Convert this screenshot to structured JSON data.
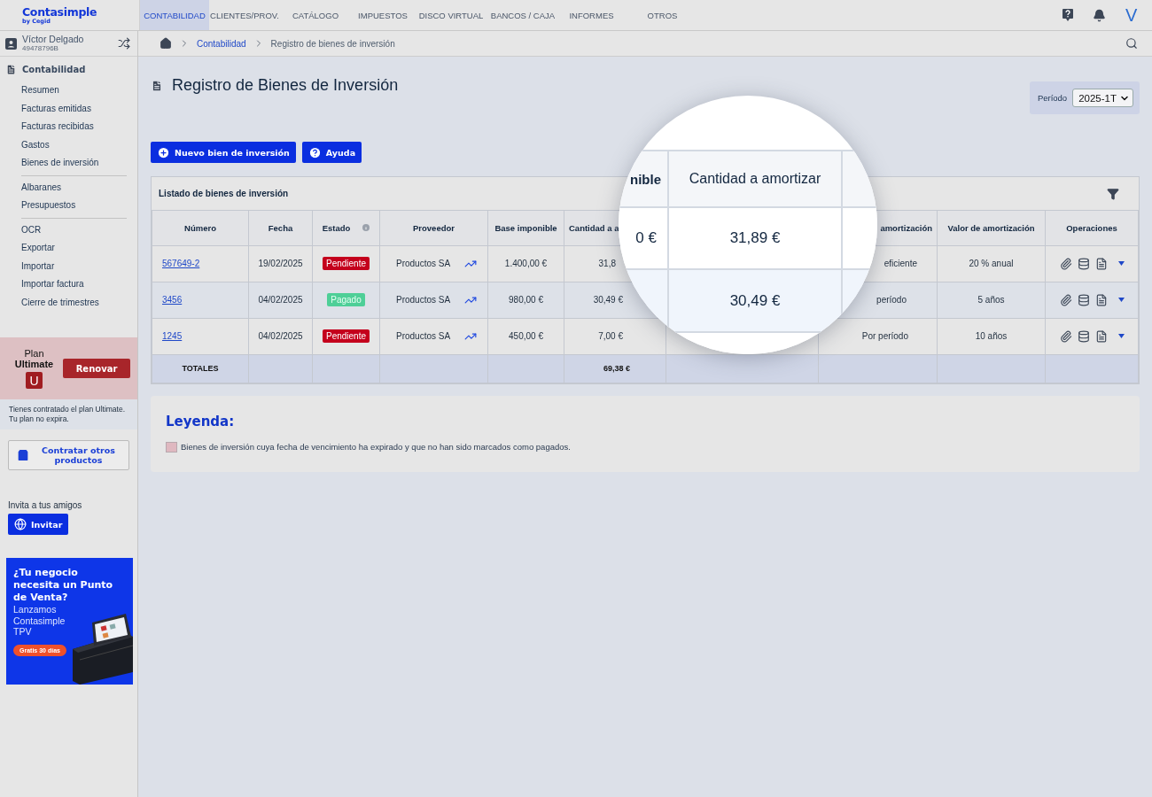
{
  "top_nav": {
    "logo": "Contasimple",
    "logo_sub": "by Cegid",
    "avatar": "V",
    "tabs": [
      {
        "label": "CONTABILIDAD",
        "selected": true
      },
      {
        "label": "CLIENTES/PROV.",
        "selected": false
      },
      {
        "label": "CATÁLOGO",
        "selected": false
      },
      {
        "label": "IMPUESTOS",
        "selected": false
      },
      {
        "label": "DISCO VIRTUAL",
        "selected": false
      },
      {
        "label": "BANCOS / CAJA",
        "selected": false
      },
      {
        "label": "INFORMES",
        "selected": false
      },
      {
        "label": "OTROS",
        "selected": false
      }
    ]
  },
  "user": {
    "name": "Víctor Delgado",
    "id": "49478796B"
  },
  "breadcrumb": {
    "link": "Contabilidad",
    "current": "Registro de bienes de inversión"
  },
  "sidebar": {
    "section": "Contabilidad",
    "groups": [
      [
        "Resumen",
        "Facturas emitidas",
        "Facturas recibidas",
        "Gastos",
        "Bienes de inversión"
      ],
      [
        "Albaranes",
        "Presupuestos"
      ],
      [
        "OCR",
        "Exportar",
        "Importar",
        "Importar factura",
        "Cierre de trimestres"
      ]
    ]
  },
  "plan": {
    "label": "Plan",
    "name": "Ultimate",
    "badge": "U",
    "button": "Renovar",
    "notes": [
      "Tienes contratado el plan Ultimate.",
      "Tu plan no expira."
    ]
  },
  "products_button": "Contratar otros productos",
  "invite": {
    "label": "Invita a tus amigos",
    "button": "Invitar"
  },
  "ad": {
    "headline": "¿Tu negocio necesita un Punto de Venta?",
    "body": "Lanzamos Contasimple TPV",
    "cta": "Gratis 30 días"
  },
  "page": {
    "title": "Registro de Bienes de Inversión",
    "period_label": "Período",
    "period": "2025-1T",
    "buttons": [
      {
        "label": "Nuevo bien de inversión",
        "kind": "add"
      },
      {
        "label": "Ayuda",
        "kind": "help"
      }
    ]
  },
  "table": {
    "title": "Listado de bienes de inversión",
    "columns": [
      "Número",
      "Fecha",
      "Estado",
      "Proveedor",
      "Base imponible",
      "Cantidad a a",
      "amortización",
      "Valor de amortización",
      "Operaciones"
    ],
    "rows": [
      {
        "number": "567649-2",
        "date": "19/02/2025",
        "status": {
          "label": "Pendiente",
          "kind": "pending"
        },
        "provider": "Productos SA",
        "base": "1.400,00 €",
        "amount": "31,8",
        "method": "eficiente",
        "value": "20 % anual"
      },
      {
        "number": "3456",
        "date": "04/02/2025",
        "status": {
          "label": "Pagado",
          "kind": "paid"
        },
        "provider": "Productos SA",
        "base": "980,00 €",
        "amount": "30,49 €",
        "method": "período",
        "value": "5 años"
      },
      {
        "number": "1245",
        "date": "04/02/2025",
        "status": {
          "label": "Pendiente",
          "kind": "pending"
        },
        "provider": "Productos SA",
        "base": "450,00 €",
        "amount": "7,00 €",
        "method": "Por período",
        "value": "10 años"
      }
    ],
    "totals": {
      "label": "TOTALES",
      "amount": "69,38 €"
    }
  },
  "magnifier": {
    "header_left": "nible",
    "header": "Cantidad a amortizar",
    "rows": [
      {
        "left": "0 €",
        "value": "31,89 €"
      },
      {
        "value": "30,49 €"
      }
    ]
  },
  "legend": {
    "title": "Leyenda:",
    "items": [
      {
        "color": "#dfb8c0",
        "text": "Bienes de inversión cuya fecha de vencimiento ha expirado y que no han sido marcados como pagados."
      }
    ]
  }
}
